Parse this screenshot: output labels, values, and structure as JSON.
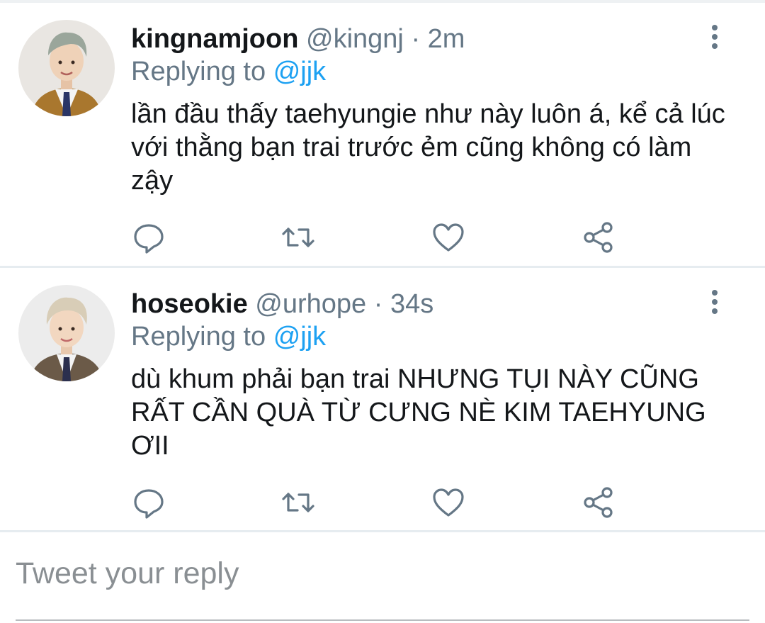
{
  "colors": {
    "accent": "#1da1f2",
    "secondary_text": "#657786",
    "primary_text": "#14171a",
    "divider": "#e6ecf0"
  },
  "tweets": [
    {
      "display_name": "kingnamjoon",
      "handle": "@kingnj",
      "separator": "·",
      "time": "2m",
      "replying_prefix": "Replying to",
      "replying_to": "@jjk",
      "text": "lần đầu thấy taehyungie như này luôn á, kể cả lúc với thằng bạn trai trước ẻm cũng không có làm zậy",
      "avatar_icon": "avatar-photo",
      "more_icon": "more-vertical-icon",
      "actions": [
        "reply-icon",
        "retweet-icon",
        "like-icon",
        "share-icon"
      ]
    },
    {
      "display_name": "hoseokie",
      "handle": "@urhope",
      "separator": "·",
      "time": "34s",
      "replying_prefix": "Replying to",
      "replying_to": "@jjk",
      "text": "dù khum phải bạn trai NHƯNG TỤI NÀY CŨNG RẤT CẦN QUÀ TỪ CƯNG NÈ KIM TAEHYUNG ƠII",
      "avatar_icon": "avatar-photo",
      "more_icon": "more-vertical-icon",
      "actions": [
        "reply-icon",
        "retweet-icon",
        "like-icon",
        "share-icon"
      ]
    }
  ],
  "reply_bar": {
    "placeholder": "Tweet your reply"
  }
}
